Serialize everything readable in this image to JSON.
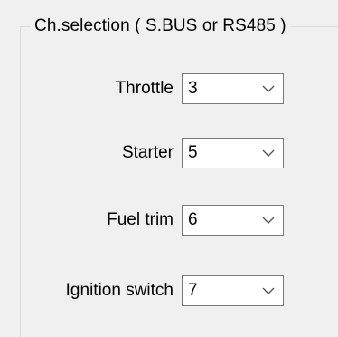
{
  "group": {
    "title": "Ch.selection ( S.BUS or RS485 )"
  },
  "channels": [
    {
      "label": "Throttle",
      "value": "3",
      "icon": "chevron-down-icon"
    },
    {
      "label": "Starter",
      "value": "5",
      "icon": "chevron-down-icon"
    },
    {
      "label": "Fuel trim",
      "value": "6",
      "icon": "chevron-down-icon"
    },
    {
      "label": "Ignition switch",
      "value": "7",
      "icon": "chevron-down-icon"
    }
  ],
  "colors": {
    "background": "#f0f0f0",
    "group_border": "#dcdcdc",
    "combo_border": "#7a7a7a",
    "combo_background": "#ffffff",
    "chevron": "#555555"
  }
}
